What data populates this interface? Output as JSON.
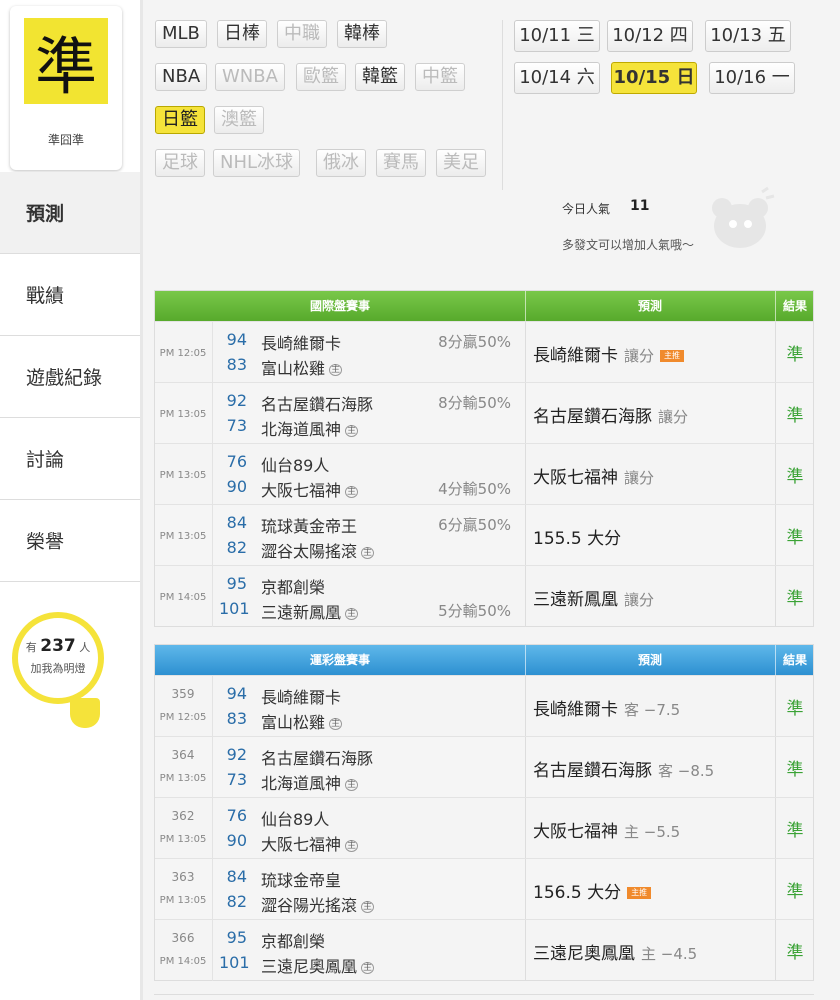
{
  "logo": {
    "char": "準",
    "name": "準囧準"
  },
  "nav": [
    {
      "label": "預測",
      "active": true
    },
    {
      "label": "戰績"
    },
    {
      "label": "遊戲紀錄"
    },
    {
      "label": "討論"
    },
    {
      "label": "榮譽"
    }
  ],
  "fans": {
    "prefix": "有",
    "count": "237",
    "suffix": "人",
    "line2": "加我為明燈"
  },
  "leagues": {
    "row1": [
      {
        "label": "MLB"
      },
      {
        "label": "日棒"
      },
      {
        "label": "中職",
        "disabled": true
      },
      {
        "label": "韓棒"
      }
    ],
    "row2": [
      {
        "label": "NBA"
      },
      {
        "label": "WNBA",
        "disabled": true
      },
      {
        "label": "歐籃",
        "disabled": true
      },
      {
        "label": "韓籃"
      },
      {
        "label": "中籃",
        "disabled": true
      }
    ],
    "row3": [
      {
        "label": "日籃",
        "active": true
      },
      {
        "label": "澳籃",
        "disabled": true
      }
    ],
    "row4": [
      {
        "label": "足球",
        "disabled": true
      },
      {
        "label": "NHL冰球",
        "disabled": true
      },
      {
        "label": "俄冰",
        "disabled": true
      },
      {
        "label": "賽馬",
        "disabled": true
      },
      {
        "label": "美足",
        "disabled": true
      }
    ]
  },
  "dates": [
    {
      "date": "10/11",
      "day": "三"
    },
    {
      "date": "10/12",
      "day": "四"
    },
    {
      "date": "10/13",
      "day": "五"
    },
    {
      "date": "10/14",
      "day": "六"
    },
    {
      "date": "10/15",
      "day": "日",
      "active": true
    },
    {
      "date": "10/16",
      "day": "一"
    }
  ],
  "popularity": {
    "label": "今日人氣",
    "count": "11",
    "hint": "多發文可以增加人氣哦～"
  },
  "intl_table": {
    "headers": [
      "國際盤賽事",
      "預測",
      "結果"
    ],
    "rows": [
      {
        "time": "PM 12:05",
        "away_score": "94",
        "away": "長崎維爾卡",
        "home_score": "83",
        "home": "富山松雞",
        "home_mark": "主",
        "odds": "8分贏50%",
        "odds_row": "away",
        "pred": "長崎維爾卡",
        "pred_sub": "讓分",
        "badge": "主推",
        "result": "準"
      },
      {
        "time": "PM 13:05",
        "away_score": "92",
        "away": "名古屋鑽石海豚",
        "home_score": "73",
        "home": "北海道風神",
        "home_mark": "主",
        "odds": "8分輸50%",
        "odds_row": "away",
        "pred": "名古屋鑽石海豚",
        "pred_sub": "讓分",
        "result": "準"
      },
      {
        "time": "PM 13:05",
        "away_score": "76",
        "away": "仙台89人",
        "home_score": "90",
        "home": "大阪七福神",
        "home_mark": "主",
        "odds": "4分輸50%",
        "odds_row": "home",
        "pred": "大阪七福神",
        "pred_sub": "讓分",
        "result": "準"
      },
      {
        "time": "PM 13:05",
        "away_score": "84",
        "away": "琉球黃金帝王",
        "home_score": "82",
        "home": "澀谷太陽搖滾",
        "home_mark": "主",
        "odds": "6分贏50%",
        "odds_row": "away",
        "pred": "155.5 大分",
        "pred_sub": "",
        "result": "準"
      },
      {
        "time": "PM 14:05",
        "away_score": "95",
        "away": "京都創榮",
        "home_score": "101",
        "home": "三遠新鳳凰",
        "home_mark": "主",
        "odds": "5分輸50%",
        "odds_row": "home",
        "pred": "三遠新鳳凰",
        "pred_sub": "讓分",
        "result": "準"
      }
    ]
  },
  "sport_table": {
    "headers": [
      "運彩盤賽事",
      "預測",
      "結果"
    ],
    "rows": [
      {
        "num": "359",
        "time": "PM 12:05",
        "away_score": "94",
        "away": "長崎維爾卡",
        "home_score": "83",
        "home": "富山松雞",
        "home_mark": "主",
        "pred": "長崎維爾卡",
        "pred_sub": "客 −7.5",
        "result": "準"
      },
      {
        "num": "364",
        "time": "PM 13:05",
        "away_score": "92",
        "away": "名古屋鑽石海豚",
        "home_score": "73",
        "home": "北海道風神",
        "home_mark": "主",
        "pred": "名古屋鑽石海豚",
        "pred_sub": "客 −8.5",
        "result": "準"
      },
      {
        "num": "362",
        "time": "PM 13:05",
        "away_score": "76",
        "away": "仙台89人",
        "home_score": "90",
        "home": "大阪七福神",
        "home_mark": "主",
        "pred": "大阪七福神",
        "pred_sub": "主 −5.5",
        "result": "準"
      },
      {
        "num": "363",
        "time": "PM 13:05",
        "away_score": "84",
        "away": "琉球金帝皇",
        "home_score": "82",
        "home": "澀谷陽光搖滾",
        "home_mark": "主",
        "pred": "156.5 大分",
        "pred_sub": "",
        "badge": "主推",
        "result": "準"
      },
      {
        "num": "366",
        "time": "PM 14:05",
        "away_score": "95",
        "away": "京都創榮",
        "home_score": "101",
        "home": "三遠尼奧鳳凰",
        "home_mark": "主",
        "pred": "三遠尼奧鳳凰",
        "pred_sub": "主 −4.5",
        "result": "準"
      }
    ]
  }
}
